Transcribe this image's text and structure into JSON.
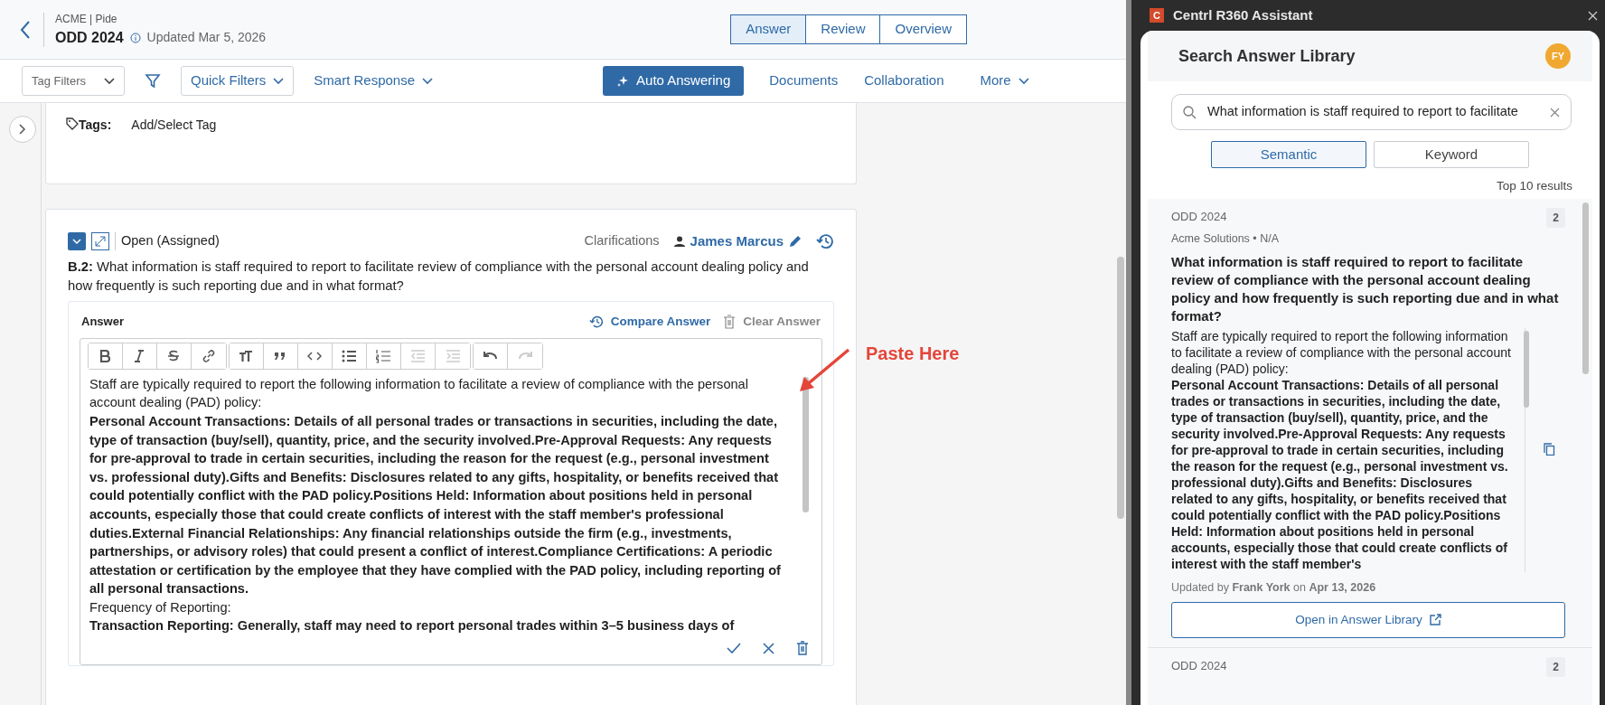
{
  "header": {
    "breadcrumb": "ACME | Pide",
    "title": "ODD 2024",
    "updated": "Updated Mar 5, 2026"
  },
  "view_tabs": [
    {
      "label": "Answer",
      "selected": true
    },
    {
      "label": "Review",
      "selected": false
    },
    {
      "label": "Overview",
      "selected": false
    }
  ],
  "toolbar": {
    "tag_filters": {
      "placeholder": "Tag Filters"
    },
    "quick_filters": "Quick Filters",
    "smart_response": "Smart Response",
    "auto_answering": "Auto Answering",
    "links": [
      "Documents",
      "Collaboration"
    ],
    "more": "More"
  },
  "tags_card": {
    "label": "Tags:",
    "value": "Add/Select Tag"
  },
  "question": {
    "status": "Open (Assigned)",
    "clarifications": "Clarifications",
    "assignee": "James Marcus",
    "text": "**B.2:** What information is staff required to report to facilitate review of compliance with the personal account dealing policy and how frequently is such reporting due and in what format?",
    "answer_label": "Answer",
    "compare": "Compare Answer",
    "clear": "Clear Answer",
    "editor_toolbar": [
      {
        "tools": [
          {
            "kind": "bold",
            "disabled": false
          },
          {
            "kind": "italic",
            "disabled": false
          },
          {
            "kind": "strike",
            "disabled": false
          },
          {
            "kind": "link",
            "disabled": false
          }
        ]
      },
      {
        "tools": [
          {
            "kind": "heading",
            "disabled": false
          },
          {
            "kind": "quote",
            "disabled": false
          },
          {
            "kind": "code",
            "disabled": false
          },
          {
            "kind": "bullets",
            "disabled": false
          },
          {
            "kind": "numbers",
            "disabled": false
          },
          {
            "kind": "outdent",
            "disabled": true
          },
          {
            "kind": "indent",
            "disabled": true
          }
        ]
      },
      {
        "tools": [
          {
            "kind": "undo",
            "disabled": false
          },
          {
            "kind": "redo",
            "disabled": true
          }
        ]
      }
    ],
    "answer": [
      {
        "kind": "normal",
        "text": "Staff are typically required to report the following information to facilitate a review of compliance with the personal account dealing (PAD) policy:"
      },
      {
        "kind": "bold",
        "text": "Personal Account Transactions: Details of all personal trades or transactions in securities, including the date, type of transaction (buy/sell), quantity, price, and the security involved.Pre-Approval Requests: Any requests for pre-approval to trade in certain securities, including the reason for the request (e.g., personal investment vs. professional duty).Gifts and Benefits: Disclosures related to any gifts, hospitality, or benefits received that could potentially conflict with the PAD policy.Positions Held: Information about positions held in personal accounts, especially those that could create conflicts of interest with the staff member's professional duties.External Financial Relationships: Any financial relationships outside the firm (e.g., investments, partnerships, or advisory roles) that could present a conflict of interest.Compliance Certifications: A periodic attestation or certification by the employee that they have complied with the PAD policy, including reporting of all personal transactions."
      },
      {
        "kind": "normal",
        "text": "Frequency of Reporting:"
      },
      {
        "kind": "bold",
        "text": "Transaction Reporting: Generally, staff may need to report personal trades within 3–5 business days of"
      }
    ]
  },
  "annotation": "Paste Here",
  "assistant": {
    "logo": "C",
    "title": "Centrl R360 Assistant",
    "heading": "Search Answer Library",
    "avatar": "FY",
    "search": {
      "value": "What information is staff required to report to facilitate"
    },
    "modes": [
      {
        "label": "Semantic",
        "selected": true
      },
      {
        "label": "Keyword",
        "selected": false
      }
    ],
    "result_count": "Top 10 results",
    "results": [
      {
        "source": "ODD 2024",
        "meta": "Acme Solutions • N/A",
        "count": "2",
        "question": "What information is staff required to report to facilitate review of compliance with the personal account dealing policy and how frequently is such reporting due and in what format?",
        "answer": [
          {
            "kind": "normal",
            "text": "Staff are typically required to report the following information to facilitate a review of compliance with the personal account dealing (PAD) policy:"
          },
          {
            "kind": "bold",
            "text": "Personal Account Transactions: Details of all personal trades or transactions in securities, including the date, type of transaction (buy/sell), quantity, price, and the security involved.Pre-Approval Requests: Any requests for pre-approval to trade in certain securities, including the reason for the request (e.g., personal investment vs. professional duty).Gifts and Benefits: Disclosures related to any gifts, hospitality, or benefits received that could potentially conflict with the PAD policy.Positions Held: Information about positions held in personal accounts, especially those that could create conflicts of interest with the staff member's"
          }
        ],
        "updated": "Updated by **Frank York** on **Apr 13, 2026**",
        "open_button": "Open in Answer Library"
      },
      {
        "source": "ODD 2024",
        "count": "2"
      }
    ]
  }
}
